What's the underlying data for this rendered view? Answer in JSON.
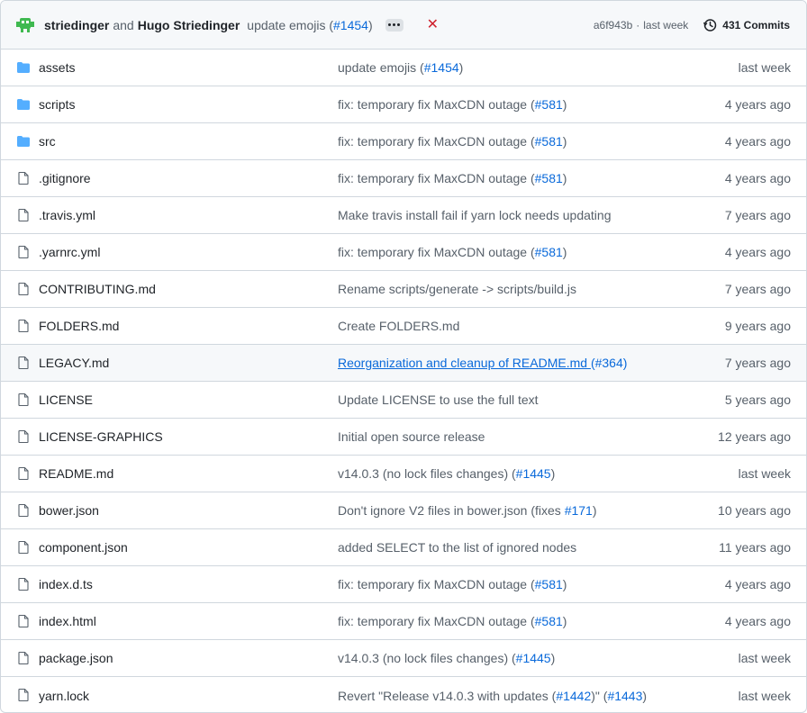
{
  "header": {
    "author1": "striedinger",
    "and": "and",
    "author2": "Hugo Striedinger",
    "message": "update emojis",
    "pr_prefix": "(",
    "pr": "#1454",
    "pr_suffix": ")",
    "sha": "a6f943b",
    "dot": "·",
    "when": "last week",
    "commits": "431 Commits"
  },
  "colors": {
    "link": "#0969da",
    "folder": "#54aeff",
    "muted": "#57606a",
    "danger": "#cf222e"
  },
  "files": [
    {
      "type": "folder",
      "icon": "folder-icon",
      "name": "assets",
      "commit": "update emojis (",
      "pr": "#1454",
      "suffix": ")",
      "age": "last week"
    },
    {
      "type": "folder",
      "icon": "folder-icon",
      "name": "scripts",
      "commit": "fix: temporary fix MaxCDN outage (",
      "pr": "#581",
      "suffix": ")",
      "age": "4 years ago"
    },
    {
      "type": "folder",
      "icon": "folder-icon",
      "name": "src",
      "commit": "fix: temporary fix MaxCDN outage (",
      "pr": "#581",
      "suffix": ")",
      "age": "4 years ago"
    },
    {
      "type": "file",
      "icon": "file-icon",
      "name": ".gitignore",
      "commit": "fix: temporary fix MaxCDN outage (",
      "pr": "#581",
      "suffix": ")",
      "age": "4 years ago"
    },
    {
      "type": "file",
      "icon": "file-icon",
      "name": ".travis.yml",
      "commit": "Make travis install fail if yarn lock needs updating",
      "pr": "",
      "suffix": "",
      "age": "7 years ago"
    },
    {
      "type": "file",
      "icon": "file-icon",
      "name": ".yarnrc.yml",
      "commit": "fix: temporary fix MaxCDN outage (",
      "pr": "#581",
      "suffix": ")",
      "age": "4 years ago"
    },
    {
      "type": "file",
      "icon": "file-icon",
      "name": "CONTRIBUTING.md",
      "commit": "Rename scripts/generate -> scripts/build.js",
      "pr": "",
      "suffix": "",
      "age": "7 years ago"
    },
    {
      "type": "file",
      "icon": "file-icon",
      "name": "FOLDERS.md",
      "commit": "Create FOLDERS.md",
      "pr": "",
      "suffix": "",
      "age": "9 years ago"
    },
    {
      "type": "file",
      "icon": "file-icon",
      "name": "LEGACY.md",
      "commit": "Reorganization and cleanup of README.md ",
      "pr": "(#364)",
      "suffix": "",
      "age": "7 years ago",
      "hover": true
    },
    {
      "type": "file",
      "icon": "file-icon",
      "name": "LICENSE",
      "commit": "Update LICENSE to use the full text",
      "pr": "",
      "suffix": "",
      "age": "5 years ago"
    },
    {
      "type": "file",
      "icon": "file-icon",
      "name": "LICENSE-GRAPHICS",
      "commit": "Initial open source release",
      "pr": "",
      "suffix": "",
      "age": "12 years ago"
    },
    {
      "type": "file",
      "icon": "file-icon",
      "name": "README.md",
      "commit": "v14.0.3 (no lock files changes) (",
      "pr": "#1445",
      "suffix": ")",
      "age": "last week"
    },
    {
      "type": "file",
      "icon": "file-icon",
      "name": "bower.json",
      "commit": "Don't ignore V2 files in bower.json (fixes ",
      "pr": "#171",
      "suffix": ")",
      "age": "10 years ago"
    },
    {
      "type": "file",
      "icon": "file-icon",
      "name": "component.json",
      "commit": "added SELECT to the list of ignored nodes",
      "pr": "",
      "suffix": "",
      "age": "11 years ago"
    },
    {
      "type": "file",
      "icon": "file-icon",
      "name": "index.d.ts",
      "commit": "fix: temporary fix MaxCDN outage (",
      "pr": "#581",
      "suffix": ")",
      "age": "4 years ago"
    },
    {
      "type": "file",
      "icon": "file-icon",
      "name": "index.html",
      "commit": "fix: temporary fix MaxCDN outage (",
      "pr": "#581",
      "suffix": ")",
      "age": "4 years ago"
    },
    {
      "type": "file",
      "icon": "file-icon",
      "name": "package.json",
      "commit": "v14.0.3 (no lock files changes) (",
      "pr": "#1445",
      "suffix": ")",
      "age": "last week"
    },
    {
      "type": "file",
      "icon": "file-icon",
      "name": "yarn.lock",
      "commit": "Revert \"Release v14.0.3 with updates (",
      "pr": "#1442",
      "mid": ")\" (",
      "pr2": "#1443",
      "suffix": ")",
      "age": "last week"
    }
  ]
}
